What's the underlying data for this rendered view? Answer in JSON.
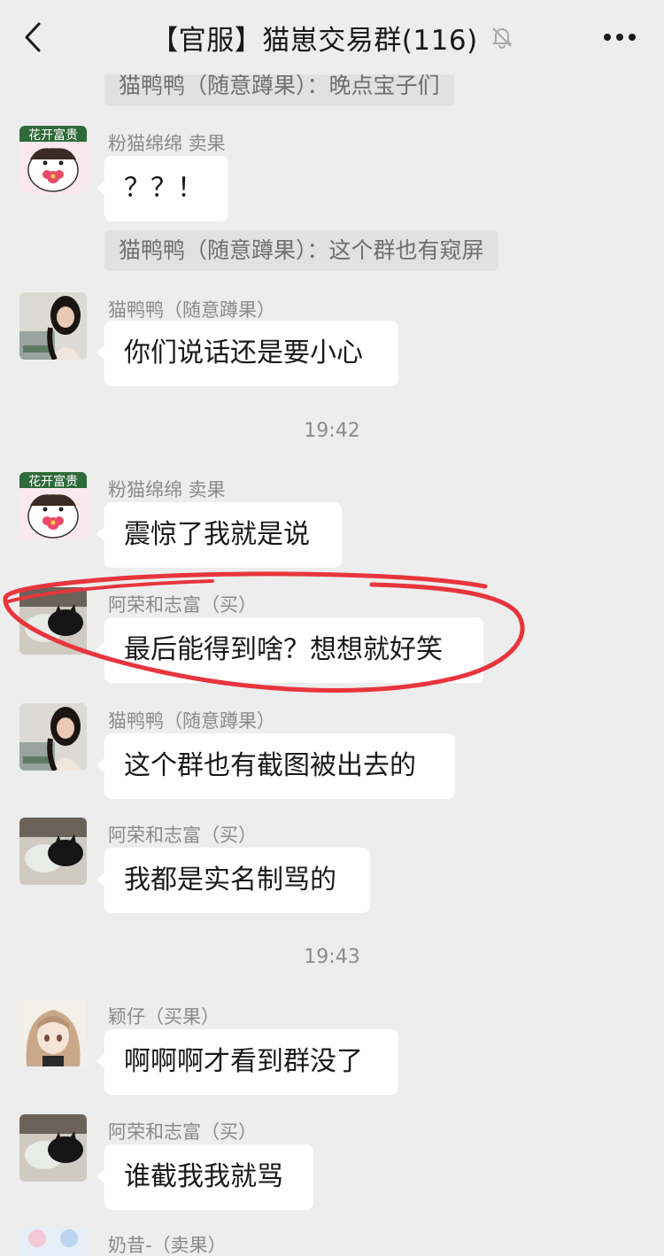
{
  "header": {
    "title": "【官服】猫崽交易群(116)",
    "back_icon": "chevron-left-icon",
    "mute_icon": "bell-off-icon",
    "more_icon": "more-horizontal-icon"
  },
  "system_messages": [
    "猫鸭鸭（随意蹲果）：晚点宝子们",
    "猫鸭鸭（随意蹲果）：这个群也有窥屏"
  ],
  "times": [
    "19:42",
    "19:43"
  ],
  "messages": [
    {
      "sender": "粉猫绵绵  卖果",
      "text": "？？！",
      "avatar": "flower-sticker-avatar"
    },
    {
      "sender": "猫鸭鸭（随意蹲果）",
      "text": "你们说话还是要小心",
      "avatar": "girl-photo-avatar"
    },
    {
      "sender": "粉猫绵绵  卖果",
      "text": "震惊了我就是说",
      "avatar": "flower-sticker-avatar"
    },
    {
      "sender": "阿荣和志富（买）",
      "text": "最后能得到啥？想想就好笑",
      "avatar": "cats-photo-avatar"
    },
    {
      "sender": "猫鸭鸭（随意蹲果）",
      "text": "这个群也有截图被出去的",
      "avatar": "girl-photo-avatar"
    },
    {
      "sender": "阿荣和志富（买）",
      "text": "我都是实名制骂的",
      "avatar": "cats-photo-avatar"
    },
    {
      "sender": "颖仔（买果）",
      "text": "啊啊啊才看到群没了",
      "avatar": "anime-girl-avatar"
    },
    {
      "sender": "阿荣和志富（买）",
      "text": "谁截我我就骂",
      "avatar": "cats-photo-avatar"
    },
    {
      "sender": "奶昔-（卖果）",
      "avatar": "anime-avatar"
    }
  ],
  "avatar_stickers": {
    "flower": "花开富贵"
  },
  "colors": {
    "background": "#ededed",
    "bubble": "#ffffff",
    "annotation": "#e8353d"
  }
}
